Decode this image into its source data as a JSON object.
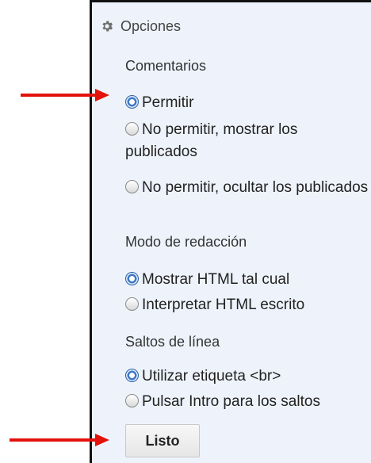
{
  "panel": {
    "header": "Opciones",
    "sections": [
      {
        "title": "Comentarios",
        "options": [
          {
            "label": "Permitir",
            "checked": true
          },
          {
            "label": "No permitir, mostrar los publicados",
            "checked": false
          },
          {
            "label": "No permitir, ocultar los publicados",
            "checked": false
          }
        ]
      },
      {
        "title": "Modo de redacción",
        "options": [
          {
            "label": "Mostrar HTML tal cual",
            "checked": true
          },
          {
            "label": "Interpretar HTML escrito",
            "checked": false
          }
        ]
      },
      {
        "title": "Saltos de línea",
        "options": [
          {
            "label": "Utilizar etiqueta <br>",
            "checked": true
          },
          {
            "label": "Pulsar Intro para los saltos",
            "checked": false
          }
        ]
      }
    ],
    "done_button": "Listo"
  },
  "colors": {
    "panel_bg": "#eef3fb",
    "arrow": "#e3120b",
    "radio_checked": "#3c78c9"
  },
  "icons": [
    "gear-icon",
    "arrow-right-icon"
  ]
}
